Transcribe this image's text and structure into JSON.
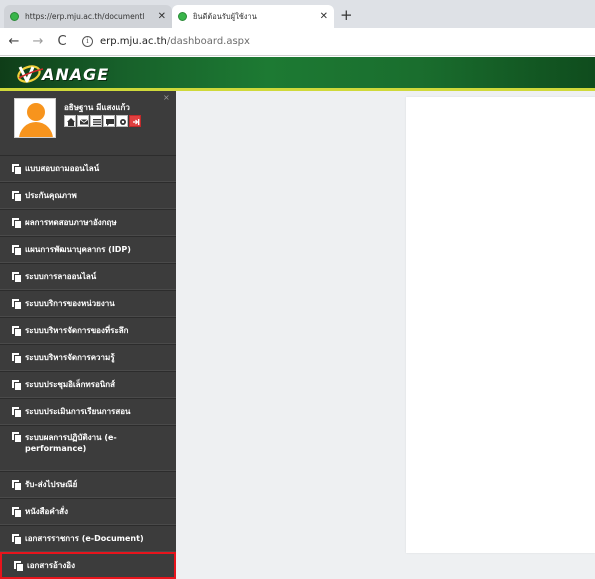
{
  "browser": {
    "tabs": [
      {
        "title": "https://erp.mju.ac.th/documentl",
        "active": false
      },
      {
        "title": "ยินดีต้อนรับผู้ใช้งาน",
        "active": true
      }
    ],
    "new_tab_label": "+",
    "back_icon": "←",
    "forward_icon": "→",
    "reload_icon": "C",
    "url_host": "erp.mju.ac.th",
    "url_path": "/dashboard.aspx"
  },
  "site": {
    "logo_text": "ANAGE",
    "header_color": "#1d7a33",
    "accent_stripe": "#cfd93a"
  },
  "profile": {
    "name": "อธิษฐาน มีแสงแก้ว",
    "close_label": "×",
    "quick_icons": [
      "home-icon",
      "mail-icon",
      "list-icon",
      "chat-icon",
      "gear-icon",
      "logout-icon"
    ]
  },
  "sidebar": {
    "items": [
      {
        "label": "แบบสอบถามออนไลน์"
      },
      {
        "label": "ประกันคุณภาพ"
      },
      {
        "label": "ผลการทดสอบภาษาอังกฤษ"
      },
      {
        "label": "แผนการพัฒนาบุคลากร (IDP)"
      },
      {
        "label": "ระบบการลาออนไลน์"
      },
      {
        "label": "ระบบบริการของหน่วยงาน"
      },
      {
        "label": "ระบบบริหารจัดการของที่ระลึก"
      },
      {
        "label": "ระบบบริหารจัดการความรู้"
      },
      {
        "label": "ระบบประชุมอิเล็กทรอนิกส์"
      },
      {
        "label": "ระบบประเมินการเรียนการสอน"
      },
      {
        "label": "ระบบผลการปฏิบัติงาน (e-performance)"
      },
      {
        "label": "รับ-ส่งไปรษณีย์"
      },
      {
        "label": "หนังสือคำสั่ง"
      },
      {
        "label": "เอกสารราชการ (e-Document)"
      },
      {
        "label": "เอกสารอ้างอิง"
      }
    ],
    "highlight_color": "#e8141c"
  }
}
